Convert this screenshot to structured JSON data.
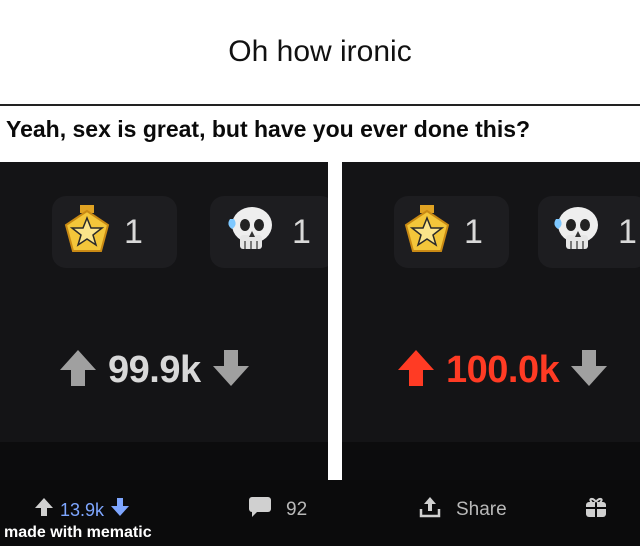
{
  "caption": "Oh how ironic",
  "meme": {
    "header": "Yeah, sex is great, but have you ever done this?",
    "left_panel": {
      "awards": [
        {
          "icon": "star-medal-icon",
          "count": "1"
        },
        {
          "icon": "skull-icon",
          "count": "1"
        }
      ],
      "score": "99.9k",
      "upvoted": false
    },
    "right_panel": {
      "awards": [
        {
          "icon": "star-medal-icon",
          "count": "1"
        },
        {
          "icon": "skull-icon",
          "count": "1"
        }
      ],
      "score": "100.0k",
      "upvoted": true
    },
    "post_bar": {
      "score": "13.9k",
      "comments": "92",
      "share_label": "Share",
      "icons": [
        "upvote-arrow-icon",
        "downvote-arrow-icon",
        "comment-icon",
        "share-icon",
        "gift-icon"
      ]
    },
    "watermark": "made with mematic"
  },
  "colors": {
    "upvote_active": "#ff3b24",
    "arrow_inactive": "#9a9a9a",
    "downvote_active": "#7ea6ff",
    "panel_bg": "#141416"
  }
}
